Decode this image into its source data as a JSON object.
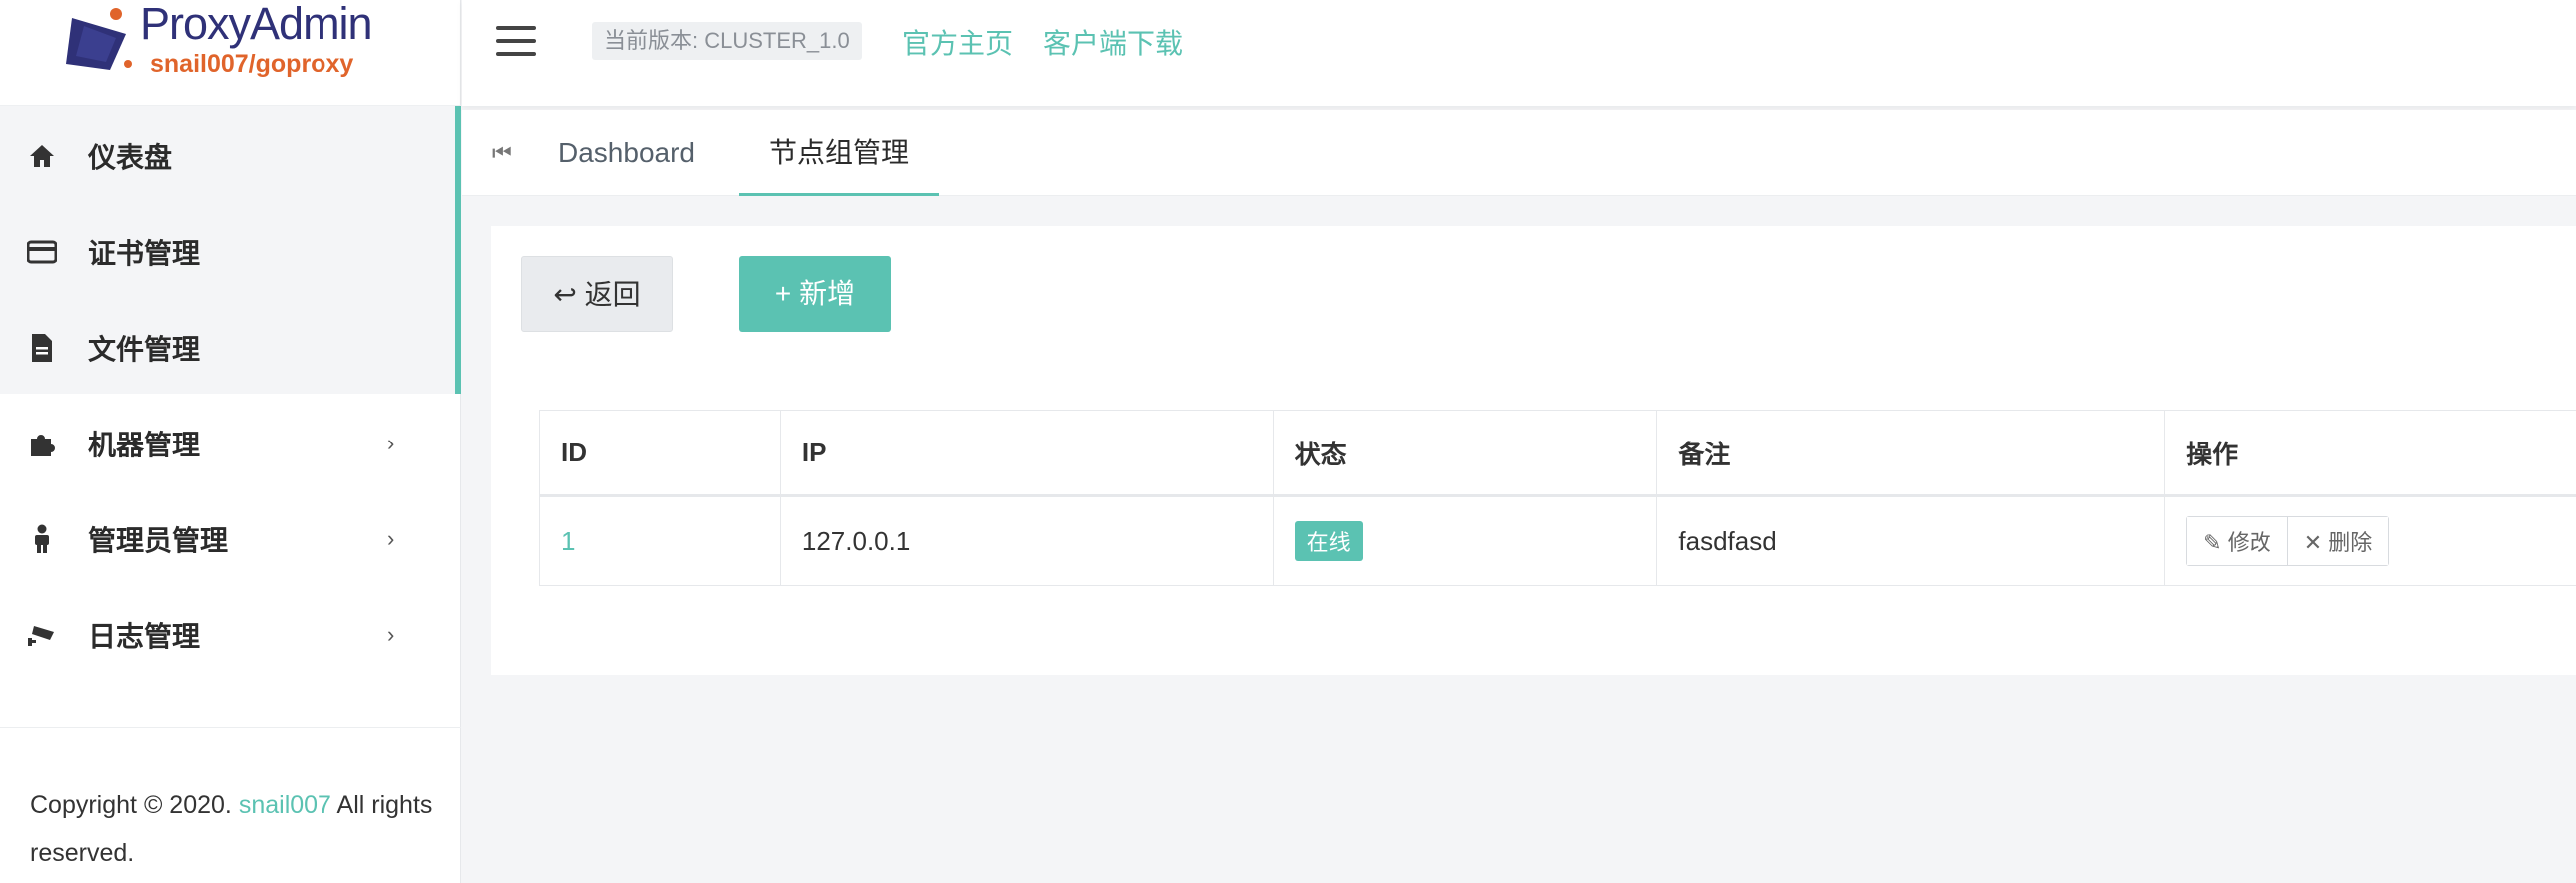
{
  "logo": {
    "title": "ProxyAdmin",
    "subtitle": "snail007/goproxy"
  },
  "sidebar": {
    "items": [
      {
        "label": "仪表盘",
        "icon": "home-icon"
      },
      {
        "label": "证书管理",
        "icon": "credit-card-icon"
      },
      {
        "label": "文件管理",
        "icon": "file-icon"
      },
      {
        "label": "机器管理",
        "icon": "puzzle-icon",
        "expandable": true
      },
      {
        "label": "管理员管理",
        "icon": "person-icon",
        "expandable": true
      },
      {
        "label": "日志管理",
        "icon": "camera-icon",
        "expandable": true
      }
    ],
    "chevron": "›",
    "copyright_prefix": "Copyright © 2020.",
    "copyright_link": "snail007",
    "copyright_suffix": "All rights reserved."
  },
  "header": {
    "version": "当前版本: CLUSTER_1.0",
    "links": [
      "官方主页",
      "客户端下载"
    ]
  },
  "tabs": {
    "prev_icon": "⏮",
    "items": [
      "Dashboard",
      "节点组管理"
    ],
    "active": 1
  },
  "toolbar": {
    "back_label": "返回",
    "back_icon": "↩",
    "add_label": "新增",
    "add_icon": "+"
  },
  "table": {
    "columns": [
      "ID",
      "IP",
      "状态",
      "备注",
      "操作"
    ],
    "rows": [
      {
        "id": "1",
        "ip": "127.0.0.1",
        "status": "在线",
        "note": "fasdfasd",
        "edit": "修改",
        "delete": "删除"
      }
    ]
  },
  "colors": {
    "accent": "#5bc2b2",
    "logo_title": "#2f3178",
    "logo_subtitle": "#e0642b"
  }
}
